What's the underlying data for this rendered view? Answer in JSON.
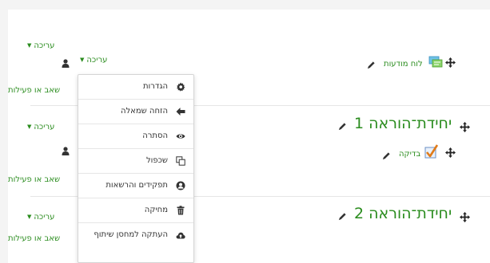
{
  "colors": {
    "link_green": "#2a8c1e",
    "text": "#333333",
    "icon_dark": "#333333"
  },
  "top_section": {
    "edit_label": "עריכה",
    "user_edit_label": "עריכה",
    "add_label": "הוספת משאב או פעילות",
    "add_visible": "שאב או פעילות",
    "activity_name": "לוח מודעות",
    "activity_icon": "forum-icon"
  },
  "section1": {
    "title": "יחידת־הוראה 1",
    "edit_label": "עריכה",
    "add_visible": "שאב או פעילות",
    "activity_name": "בדיקה",
    "activity_icon": "assignment-icon"
  },
  "section2": {
    "title": "יחידת־הוראה 2",
    "edit_label": "עריכה",
    "add_visible": "שאב או פעילות"
  },
  "edit_menu": {
    "items": [
      {
        "label": "הגדרות",
        "icon": "gear-icon"
      },
      {
        "label": "הזחה שמאלה",
        "icon": "arrow-left-icon"
      },
      {
        "label": "הסתרה",
        "icon": "eye-icon"
      },
      {
        "label": "שכפול",
        "icon": "duplicate-icon"
      },
      {
        "label": "תפקידים והרשאות",
        "icon": "user-circle-icon"
      },
      {
        "label": "מחיקה",
        "icon": "trash-icon"
      },
      {
        "label": "העתקה למחסן שיתוף",
        "icon": "cloud-upload-icon"
      }
    ]
  }
}
